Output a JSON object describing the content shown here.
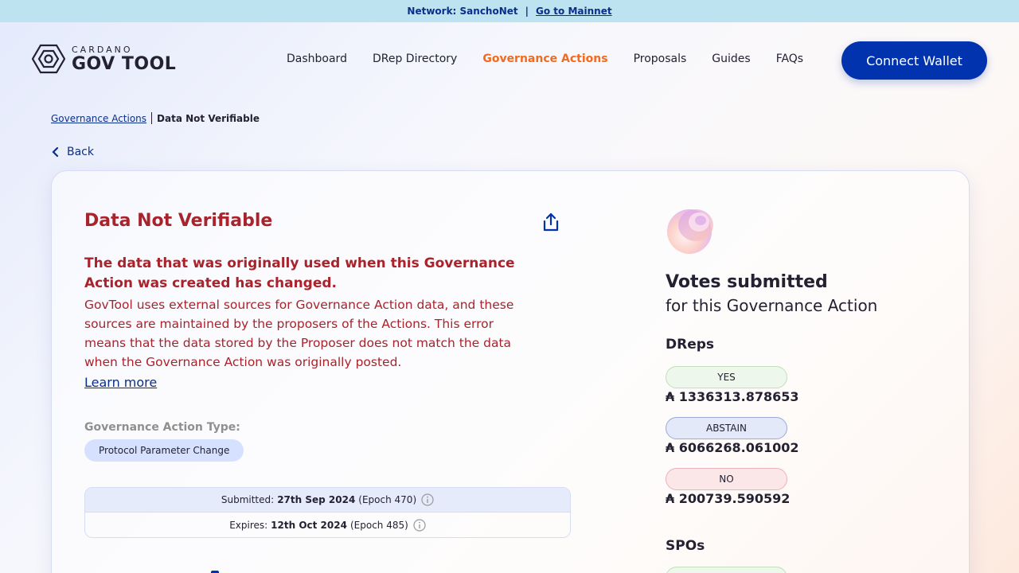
{
  "topbar": {
    "network_label": "Network: SanchoNet",
    "separator": "|",
    "mainnet_link": "Go to Mainnet"
  },
  "logo": {
    "small": "CARDANO",
    "big": "GOV TOOL"
  },
  "nav": {
    "items": [
      {
        "label": "Dashboard"
      },
      {
        "label": "DRep Directory"
      },
      {
        "label": "Governance Actions"
      },
      {
        "label": "Proposals"
      },
      {
        "label": "Guides"
      },
      {
        "label": "FAQs"
      }
    ],
    "active": "Governance Actions",
    "connect_label": "Connect Wallet"
  },
  "breadcrumb": {
    "parent": "Governance Actions",
    "current": "Data Not Verifiable"
  },
  "back_label": "Back",
  "action": {
    "title": "Data Not Verifiable",
    "subtitle": "The data that was originally used when this Governance Action was created has changed.",
    "description": "GovTool uses external sources for Governance Action data, and these sources are maintained by the proposers of the Actions. This error means that the data stored by the Proposer does not match the data when the Governance Action was originally posted.",
    "learn_more": "Learn more",
    "type_label": "Governance Action Type:",
    "type_value": "Protocol Parameter Change",
    "submitted": {
      "label": "Submitted:",
      "date": "27th Sep 2024",
      "epoch": "(Epoch 470)"
    },
    "expires": {
      "label": "Expires:",
      "date": "12th Oct 2024",
      "epoch": "(Epoch 485)"
    }
  },
  "votes": {
    "heading": "Votes submitted",
    "subheading": "for this Governance Action",
    "dreps": {
      "label": "DReps",
      "yes": {
        "label": "YES",
        "value": "₳ 1336313.878653"
      },
      "abstain": {
        "label": "ABSTAIN",
        "value": "₳ 6066268.061002"
      },
      "no": {
        "label": "NO",
        "value": "₳ 200739.590592"
      }
    },
    "spos": {
      "label": "SPOs"
    }
  },
  "colors": {
    "accent": "#0033ad",
    "active_nav": "#f26a1b",
    "error_text": "#a8232c",
    "topbar": "#bde3f0"
  }
}
